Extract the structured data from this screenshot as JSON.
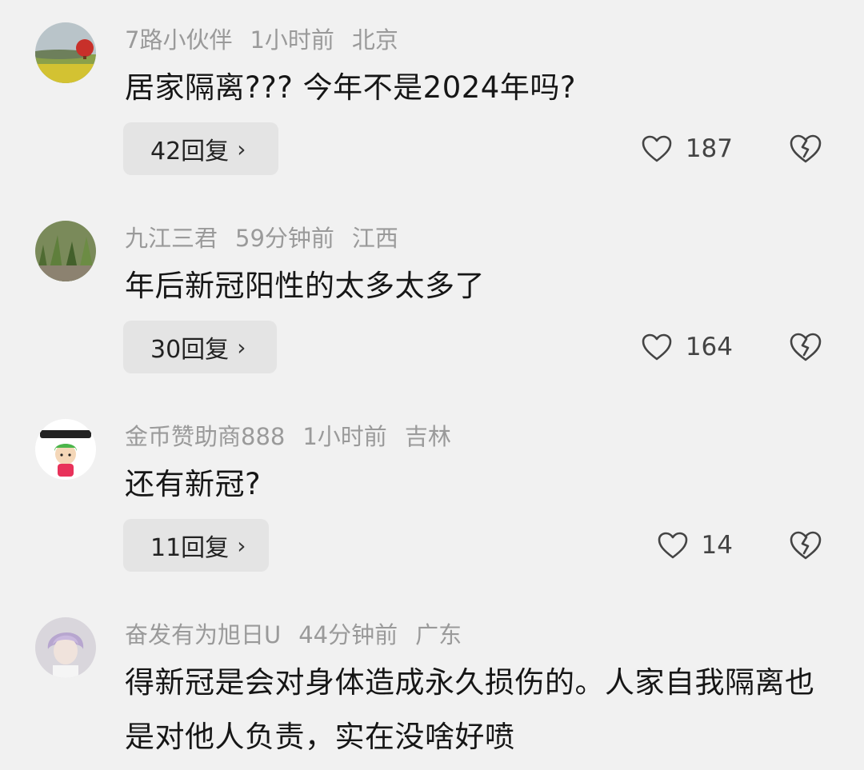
{
  "comments": [
    {
      "username": "7路小伙伴",
      "time": "1小时前",
      "location": "北京",
      "text": "居家隔离??? 今年不是2024年吗?",
      "reply_label": "42回复",
      "likes": "187",
      "avatar_icon": "landscape-balloon-avatar"
    },
    {
      "username": "九江三君",
      "time": "59分钟前",
      "location": "江西",
      "text": "年后新冠阳性的太多太多了",
      "reply_label": "30回复",
      "likes": "164",
      "avatar_icon": "plants-avatar"
    },
    {
      "username": "金币赞助商888",
      "time": "1小时前",
      "location": "吉林",
      "text": "还有新冠?",
      "reply_label": "11回复",
      "likes": "14",
      "avatar_icon": "cartoon-avatar"
    },
    {
      "username": "奋发有为旭日U",
      "time": "44分钟前",
      "location": "广东",
      "text": "得新冠是会对身体造成永久损伤的。人家自我隔离也是对他人负责，实在没啥好喷"
    }
  ],
  "icons": {
    "reply_chevron": "›",
    "like": "heart-outline-icon",
    "dislike": "broken-heart-icon"
  }
}
